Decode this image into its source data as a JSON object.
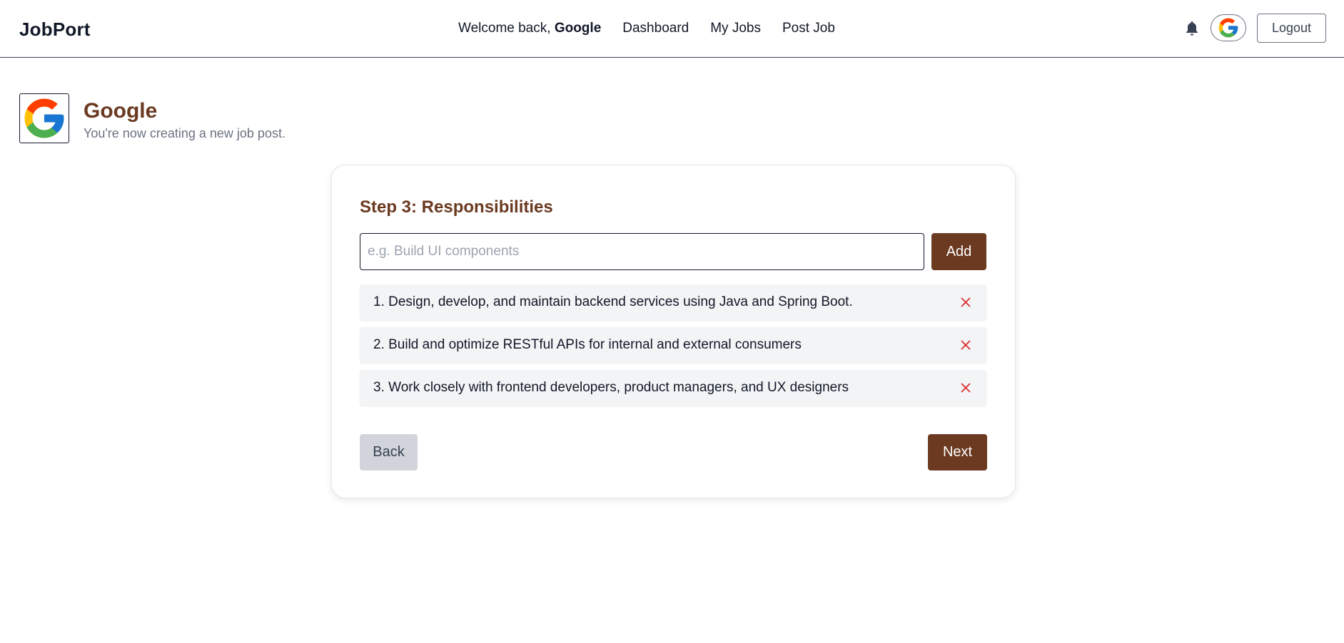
{
  "app": {
    "brand": "JobPort",
    "welcome_prefix": "Welcome back, ",
    "welcome_user": "Google",
    "nav": [
      "Dashboard",
      "My Jobs",
      "Post Job"
    ],
    "logout_label": "Logout",
    "icons": {
      "notification": "bell-icon",
      "avatar": "google-logo-icon"
    }
  },
  "company": {
    "name": "Google",
    "subtitle": "You're now creating a new job post.",
    "logo": "google-logo-icon"
  },
  "form": {
    "step_title": "Step 3: Responsibilities",
    "input_placeholder": "e.g. Build UI components",
    "input_value": "",
    "add_label": "Add",
    "responsibilities": [
      "1. Design, develop, and maintain backend services using Java and Spring Boot.",
      "2. Build and optimize RESTful APIs for internal and external consumers",
      "3. Work closely with frontend developers, product managers, and UX designers"
    ],
    "back_label": "Back",
    "next_label": "Next"
  },
  "colors": {
    "accent": "#6b3a21",
    "remove_icon": "#dc2626",
    "item_bg": "#f3f4f6",
    "back_bg": "#d1d5db"
  }
}
